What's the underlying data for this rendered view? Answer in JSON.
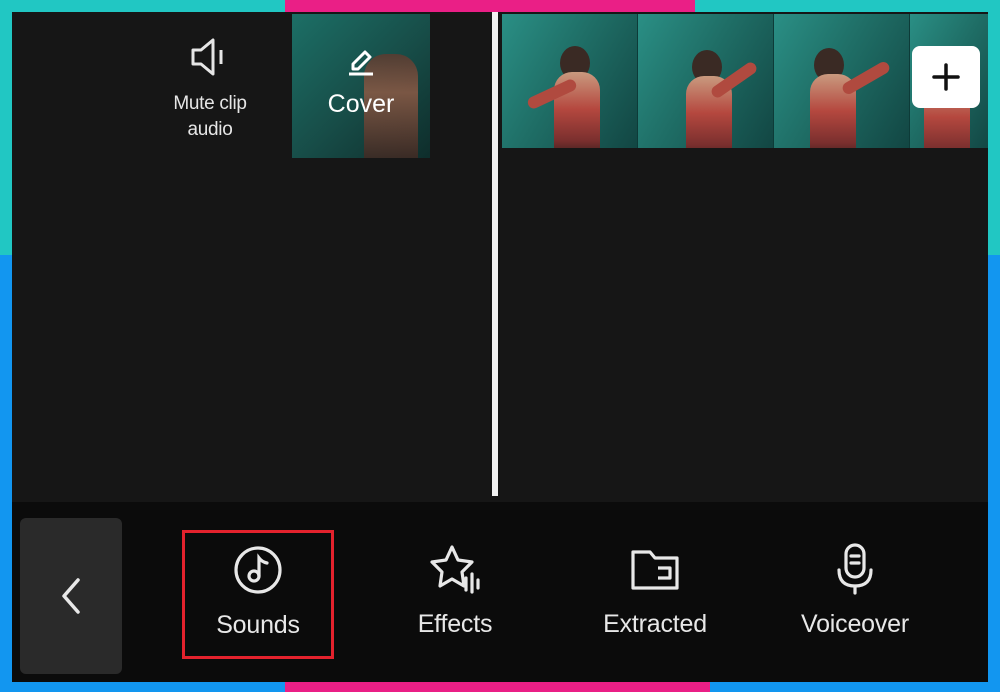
{
  "colors": {
    "frame_top": "#21c7c3",
    "frame_bottom": "#1296f0",
    "accent_pink": "#ea1f86",
    "screen_bg": "#161616",
    "toolbar_bg": "#0b0b0b",
    "highlight_red": "#e3222d"
  },
  "top_tools": {
    "mute": {
      "label": "Mute clip\naudio",
      "icon": "speaker-mute-icon"
    },
    "cover": {
      "label": "Cover",
      "icon": "pencil-icon"
    }
  },
  "timeline": {
    "add_clip_icon": "plus-icon"
  },
  "toolbar": {
    "back_icon": "chevron-left-icon",
    "items": [
      {
        "label": "Sounds",
        "icon": "music-note-icon",
        "highlighted": true
      },
      {
        "label": "Effects",
        "icon": "star-sound-icon",
        "highlighted": false
      },
      {
        "label": "Extracted",
        "icon": "folder-icon",
        "highlighted": false
      },
      {
        "label": "Voiceover",
        "icon": "microphone-icon",
        "highlighted": false
      }
    ]
  }
}
